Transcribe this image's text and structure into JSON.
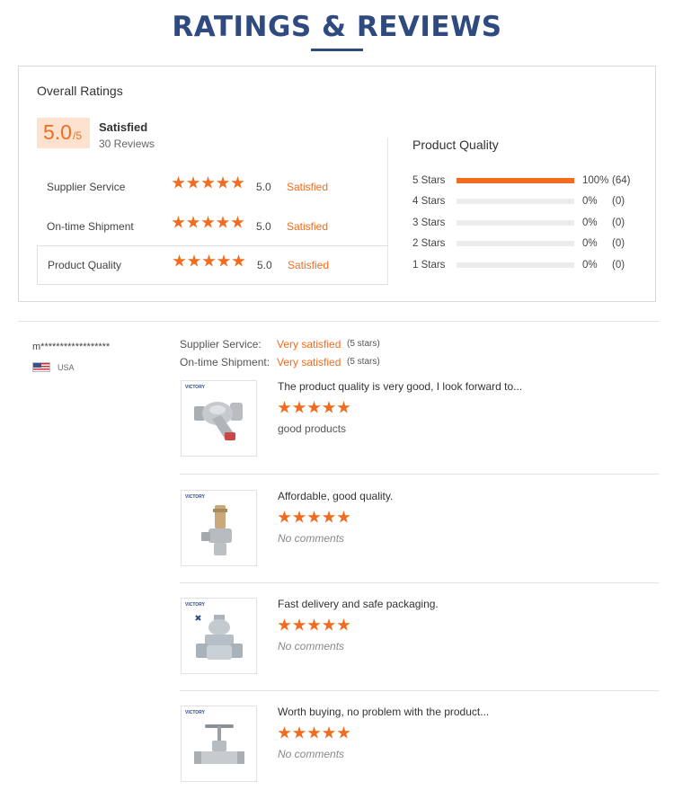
{
  "header": {
    "title": "RATINGS & REVIEWS"
  },
  "overall": {
    "label": "Overall Ratings",
    "score": "5.0",
    "score_denominator": "/5",
    "status": "Satisfied",
    "reviews_count": "30 Reviews",
    "rows": [
      {
        "label": "Supplier Service",
        "score": "5.0",
        "status": "Satisfied",
        "stars": 5
      },
      {
        "label": "On-time Shipment",
        "score": "5.0",
        "status": "Satisfied",
        "stars": 5
      },
      {
        "label": "Product Quality",
        "score": "5.0",
        "status": "Satisfied",
        "stars": 5
      }
    ]
  },
  "product_quality": {
    "title": "Product Quality",
    "distribution": [
      {
        "label": "5  Stars",
        "percent": "100%",
        "count": "(64)",
        "fill": 1.0
      },
      {
        "label": "4  Stars",
        "percent": "0%",
        "count": "(0)",
        "fill": 0
      },
      {
        "label": "3  Stars",
        "percent": "0%",
        "count": "(0)",
        "fill": 0
      },
      {
        "label": "2  Stars",
        "percent": "0%",
        "count": "(0)",
        "fill": 0
      },
      {
        "label": "1  Stars",
        "percent": "0%",
        "count": "(0)",
        "fill": 0
      }
    ]
  },
  "review": {
    "reviewer": "m******************",
    "country": "USA",
    "flag_icon": "usa-flag-icon",
    "supplier_service": {
      "label": "Supplier Service:",
      "value": "Very satisfied",
      "note": "(5 stars)"
    },
    "shipment": {
      "label": "On-time Shipment:",
      "value": "Very satisfied",
      "note": "(5 stars)"
    },
    "items": [
      {
        "brand": "VICTORY",
        "text": "The product quality is very good, I look forward to...",
        "stars": 5,
        "comment": "good products",
        "has_comment": true
      },
      {
        "brand": "VICTORY",
        "text": "Affordable, good quality.",
        "stars": 5,
        "comment": "No comments",
        "has_comment": false
      },
      {
        "brand": "VICTORY",
        "text": "Fast delivery and safe packaging.",
        "stars": 5,
        "comment": "No comments",
        "has_comment": false
      },
      {
        "brand": "VICTORY",
        "text": "Worth buying, no problem with the product...",
        "stars": 5,
        "comment": "No comments",
        "has_comment": false
      }
    ]
  },
  "colors": {
    "accent": "#f26c1f",
    "title": "#2e4a7f",
    "badge_bg": "#fde2cf",
    "track": "#ececec"
  }
}
